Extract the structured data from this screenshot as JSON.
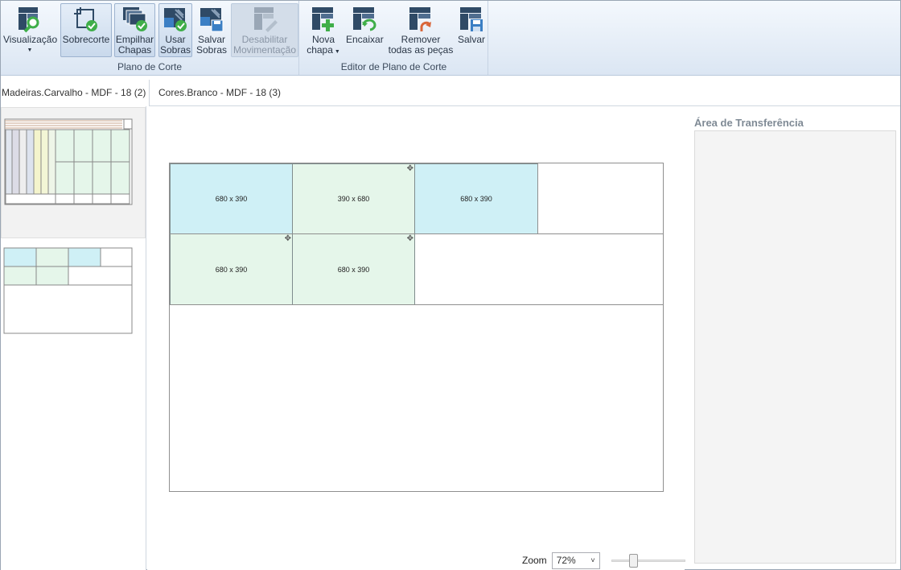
{
  "ribbon": {
    "groups": {
      "plano": {
        "label": "Plano de Corte"
      },
      "editor": {
        "label": "Editor de Plano de Corte"
      }
    },
    "buttons": {
      "visualizacao": {
        "label": "Visualização",
        "icon": "view-magnifier-icon"
      },
      "sobrecorte": {
        "label": "Sobrecorte",
        "icon": "overcut-check-icon",
        "active": true
      },
      "empilhar": {
        "line1": "Empilhar",
        "line2": "Chapas",
        "icon": "stack-sheets-check-icon",
        "active": true
      },
      "usar_sobras": {
        "line1": "Usar",
        "line2": "Sobras",
        "icon": "use-leftovers-check-icon",
        "active": true
      },
      "salvar_sobras": {
        "line1": "Salvar",
        "line2": "Sobras",
        "icon": "save-leftovers-icon"
      },
      "desabilitar": {
        "line1": "Desabilitar",
        "line2": "Movimentação",
        "icon": "disable-movement-icon",
        "disabled": true
      },
      "nova_chapa": {
        "line1": "Nova",
        "line2": "chapa",
        "icon": "new-sheet-plus-icon"
      },
      "encaixar": {
        "label": "Encaixar",
        "icon": "fit-undo-icon"
      },
      "remover": {
        "line1": "Remover",
        "line2": "todas as peças",
        "icon": "remove-pieces-icon"
      },
      "salvar": {
        "label": "Salvar",
        "icon": "save-disk-icon"
      }
    }
  },
  "tabs": [
    {
      "label": "Madeiras.Carvalho - MDF - 18 (2)",
      "selected": true
    },
    {
      "label": "Cores.Branco - MDF - 18 (3)",
      "selected": false
    }
  ],
  "sheet": {
    "pieces": [
      {
        "label": "680 x 390",
        "color": "#cff0f6"
      },
      {
        "label": "390 x 680",
        "color": "#e5f6ea",
        "movable": true
      },
      {
        "label": "680 x 390",
        "color": "#cff0f6"
      },
      {
        "label": "680 x 390",
        "color": "#e5f6ea",
        "movable": true
      },
      {
        "label": "680 x 390",
        "color": "#e5f6ea",
        "movable": true
      }
    ]
  },
  "zoom": {
    "label": "Zoom",
    "value": "72%"
  },
  "transfer": {
    "title": "Área de Transferência"
  },
  "colors": {
    "piece_blue": "#cff0f6",
    "piece_green": "#e5f6ea",
    "ribbon_accent": "#2f4a66",
    "check_green": "#3fae49"
  }
}
